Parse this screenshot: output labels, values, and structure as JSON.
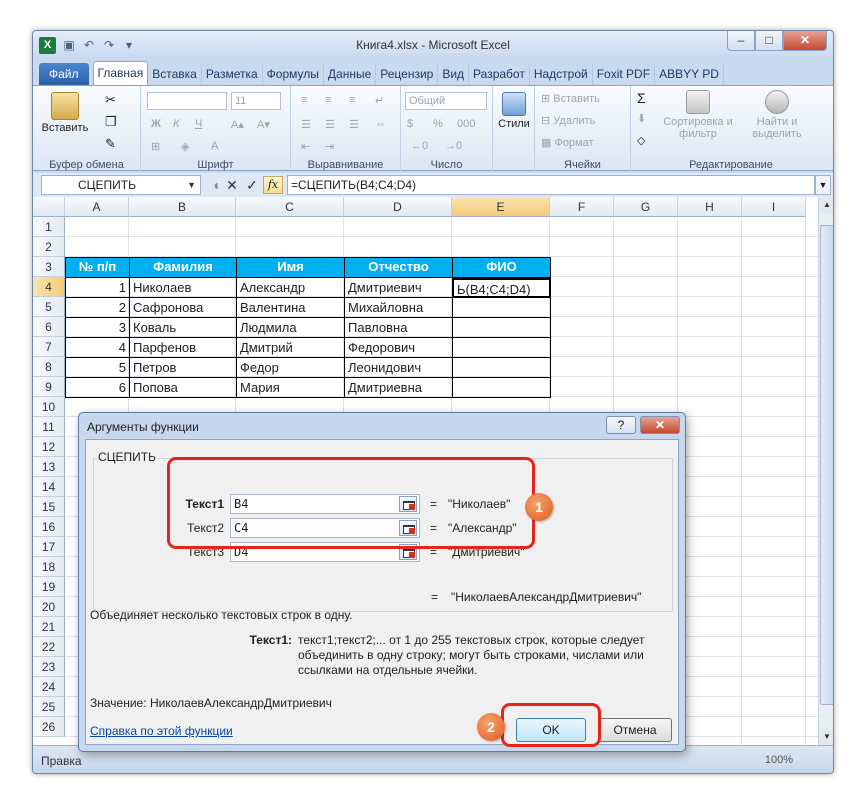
{
  "window": {
    "title": "Книга4.xlsx  -  Microsoft Excel"
  },
  "tabs": [
    {
      "label": "Файл",
      "kind": "file"
    },
    {
      "label": "Главная",
      "active": true
    },
    {
      "label": "Вставка"
    },
    {
      "label": "Разметка"
    },
    {
      "label": "Формулы"
    },
    {
      "label": "Данные"
    },
    {
      "label": "Рецензир"
    },
    {
      "label": "Вид"
    },
    {
      "label": "Разработ"
    },
    {
      "label": "Надстрой"
    },
    {
      "label": "Foxit PDF"
    },
    {
      "label": "ABBYY PD"
    }
  ],
  "ribbon": {
    "clipboard": {
      "label": "Буфер обмена",
      "paste": "Вставить"
    },
    "font": {
      "label": "Шрифт",
      "size": "11",
      "bold": "Ж",
      "italic": "К",
      "underline": "Ч"
    },
    "alignment": {
      "label": "Выравнивание"
    },
    "number": {
      "label": "Число",
      "format": "Общий",
      "percent": "%",
      "thousands": "000"
    },
    "styles": {
      "label": "Стили"
    },
    "cells": {
      "label": "Ячейки",
      "insert": "Вставить",
      "delete": "Удалить",
      "format": "Формат"
    },
    "editing": {
      "label": "Редактирование",
      "sort": "Сортировка и фильтр",
      "find": "Найти и выделить"
    }
  },
  "formula_bar": {
    "name_box": "СЦЕПИТЬ",
    "fx": "fx",
    "formula": "=СЦЕПИТЬ(B4;C4;D4)"
  },
  "columns": [
    "A",
    "B",
    "C",
    "D",
    "E",
    "F",
    "G",
    "H",
    "I"
  ],
  "rows": [
    "1",
    "2",
    "3",
    "4",
    "5",
    "6",
    "7",
    "8",
    "9",
    "10",
    "11",
    "12",
    "13",
    "14",
    "15",
    "16",
    "17",
    "18",
    "19",
    "20",
    "21",
    "22",
    "23",
    "24",
    "25",
    "26"
  ],
  "table": {
    "headers": [
      "№ п/п",
      "Фамилия",
      "Имя",
      "Отчество",
      "ФИО"
    ],
    "rows": [
      [
        "1",
        "Николаев",
        "Александр",
        "Дмитриевич",
        "Ь(B4;C4;D4)"
      ],
      [
        "2",
        "Сафронова",
        "Валентина",
        "Михайловна",
        ""
      ],
      [
        "3",
        "Коваль",
        "Людмила",
        "Павловна",
        ""
      ],
      [
        "4",
        "Парфенов",
        "Дмитрий",
        "Федорович",
        ""
      ],
      [
        "5",
        "Петров",
        "Федор",
        "Леонидович",
        ""
      ],
      [
        "6",
        "Попова",
        "Мария",
        "Дмитриевна",
        ""
      ]
    ]
  },
  "status": {
    "mode": "Правка",
    "zoom": "100%"
  },
  "dialog": {
    "title": "Аргументы функции",
    "help_btn": "?",
    "close_btn": "✕",
    "function_name": "СЦЕПИТЬ",
    "args": [
      {
        "label": "Текст1",
        "value": "B4",
        "result": "\"Николаев\"",
        "bold": true
      },
      {
        "label": "Текст2",
        "value": "C4",
        "result": "\"Александр\"",
        "bold": false
      },
      {
        "label": "Текст3",
        "value": "D4",
        "result": "\"Дмитриевич\"",
        "bold": false
      }
    ],
    "equals": "=",
    "total_result": "\"НиколаевАлександрДмитриевич\"",
    "description": "Объединяет несколько текстовых строк в одну.",
    "arg_help_label": "Текст1:",
    "arg_help_text": "текст1;текст2;... от 1 до 255 текстовых строк, которые следует объединить в одну строку; могут быть строками, числами или ссылками на отдельные ячейки.",
    "value_label": "Значение:",
    "value": "НиколаевАлександрДмитриевич",
    "help_link": "Справка по этой функции",
    "ok": "OK",
    "cancel": "Отмена"
  },
  "markers": [
    "1",
    "2"
  ],
  "colors": {
    "header_fill": "#00b0f0",
    "highlight": "#e8231c",
    "marker": "#e8702f"
  }
}
